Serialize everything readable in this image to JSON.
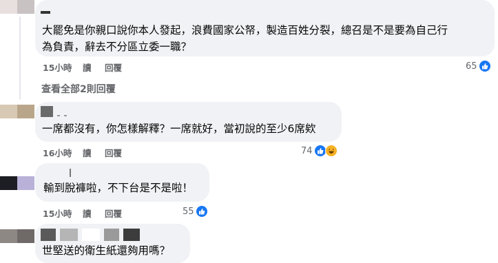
{
  "comments": [
    {
      "text": "大罷免是你親口說你本人發起，浪費國家公帑，製造百姓分裂，總召是不是要為自己行\n為負責，辭去不分區立委一職？",
      "time": "15小時",
      "read_label": "讀",
      "reply_label": "回覆",
      "reaction_count": "65"
    },
    {
      "text": "一席都沒有，你怎樣解釋？一席就好，當初說的至少6席欸",
      "time": "16小時",
      "read_label": "讀",
      "reply_label": "回覆",
      "reaction_count": "74"
    },
    {
      "text": "輸到脫褲啦，不下台是不是啦！",
      "time": "15小時",
      "read_label": "讀",
      "reply_label": "回覆",
      "reaction_count": "55"
    },
    {
      "text": "世堅送的衛生紙還夠用嗎？"
    }
  ],
  "view_replies_label": "查看全部2則回覆",
  "colors": {
    "bubble": "#f0f2f5",
    "meta_text": "#65676b",
    "like_blue": "#1877f2",
    "haha_yellow": "#f7b125"
  },
  "icons": [
    "like-icon",
    "haha-icon"
  ]
}
